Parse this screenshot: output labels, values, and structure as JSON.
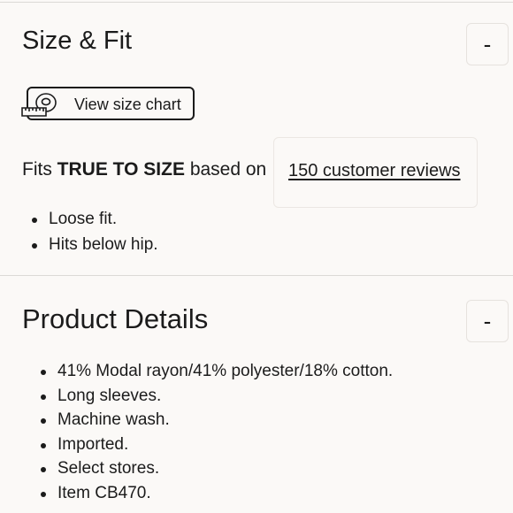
{
  "size_fit": {
    "title": "Size & Fit",
    "toggle_label": "-",
    "size_chart_label": "View size chart",
    "fits_prefix": "Fits",
    "fits_value": "TRUE TO SIZE",
    "fits_suffix": "based on",
    "reviews_link": "150 customer reviews",
    "bullets": [
      "Loose fit.",
      "Hits below hip."
    ]
  },
  "product_details": {
    "title": "Product Details",
    "toggle_label": "-",
    "bullets": [
      "41% Modal rayon/41% polyester/18% cotton.",
      "Long sleeves.",
      "Machine wash.",
      "Imported.",
      "Select stores.",
      "Item CB470."
    ]
  },
  "icons": {
    "size_chart": "measuring-tape-icon"
  }
}
